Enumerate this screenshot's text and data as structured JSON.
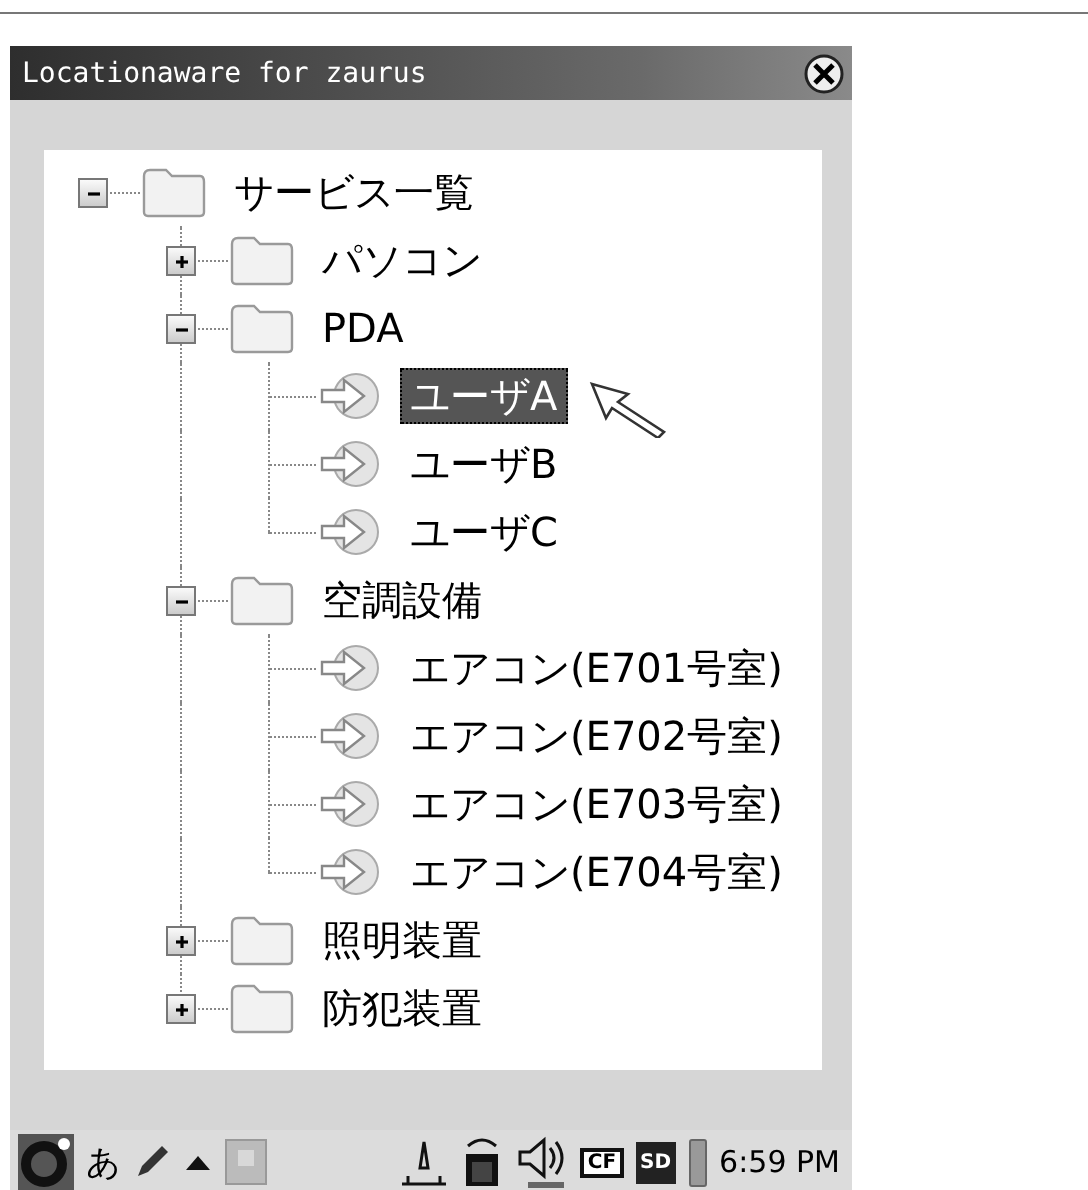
{
  "window": {
    "title": "Locationaware for zaurus"
  },
  "tree": [
    {
      "label": "サービス一覧",
      "kind": "folder",
      "expanded": true,
      "selected": false,
      "children": [
        {
          "label": "パソコン",
          "kind": "folder",
          "expanded": false,
          "selected": false
        },
        {
          "label": "PDA",
          "kind": "folder",
          "expanded": true,
          "selected": false,
          "children": [
            {
              "label": "ユーザA",
              "kind": "device",
              "selected": true
            },
            {
              "label": "ユーザB",
              "kind": "device",
              "selected": false
            },
            {
              "label": "ユーザC",
              "kind": "device",
              "selected": false
            }
          ]
        },
        {
          "label": "空調設備",
          "kind": "folder",
          "expanded": true,
          "selected": false,
          "children": [
            {
              "label": "エアコン(E701号室)",
              "kind": "device",
              "selected": false
            },
            {
              "label": "エアコン(E702号室)",
              "kind": "device",
              "selected": false
            },
            {
              "label": "エアコン(E703号室)",
              "kind": "device",
              "selected": false
            },
            {
              "label": "エアコン(E704号室)",
              "kind": "device",
              "selected": false
            }
          ]
        },
        {
          "label": "照明装置",
          "kind": "folder",
          "expanded": false,
          "selected": false
        },
        {
          "label": "防犯装置",
          "kind": "folder",
          "expanded": false,
          "selected": false
        }
      ]
    }
  ],
  "taskbar": {
    "input_mode": "あ",
    "cf_label": "CF",
    "sd_label": "SD",
    "clock": "6:59 PM"
  }
}
